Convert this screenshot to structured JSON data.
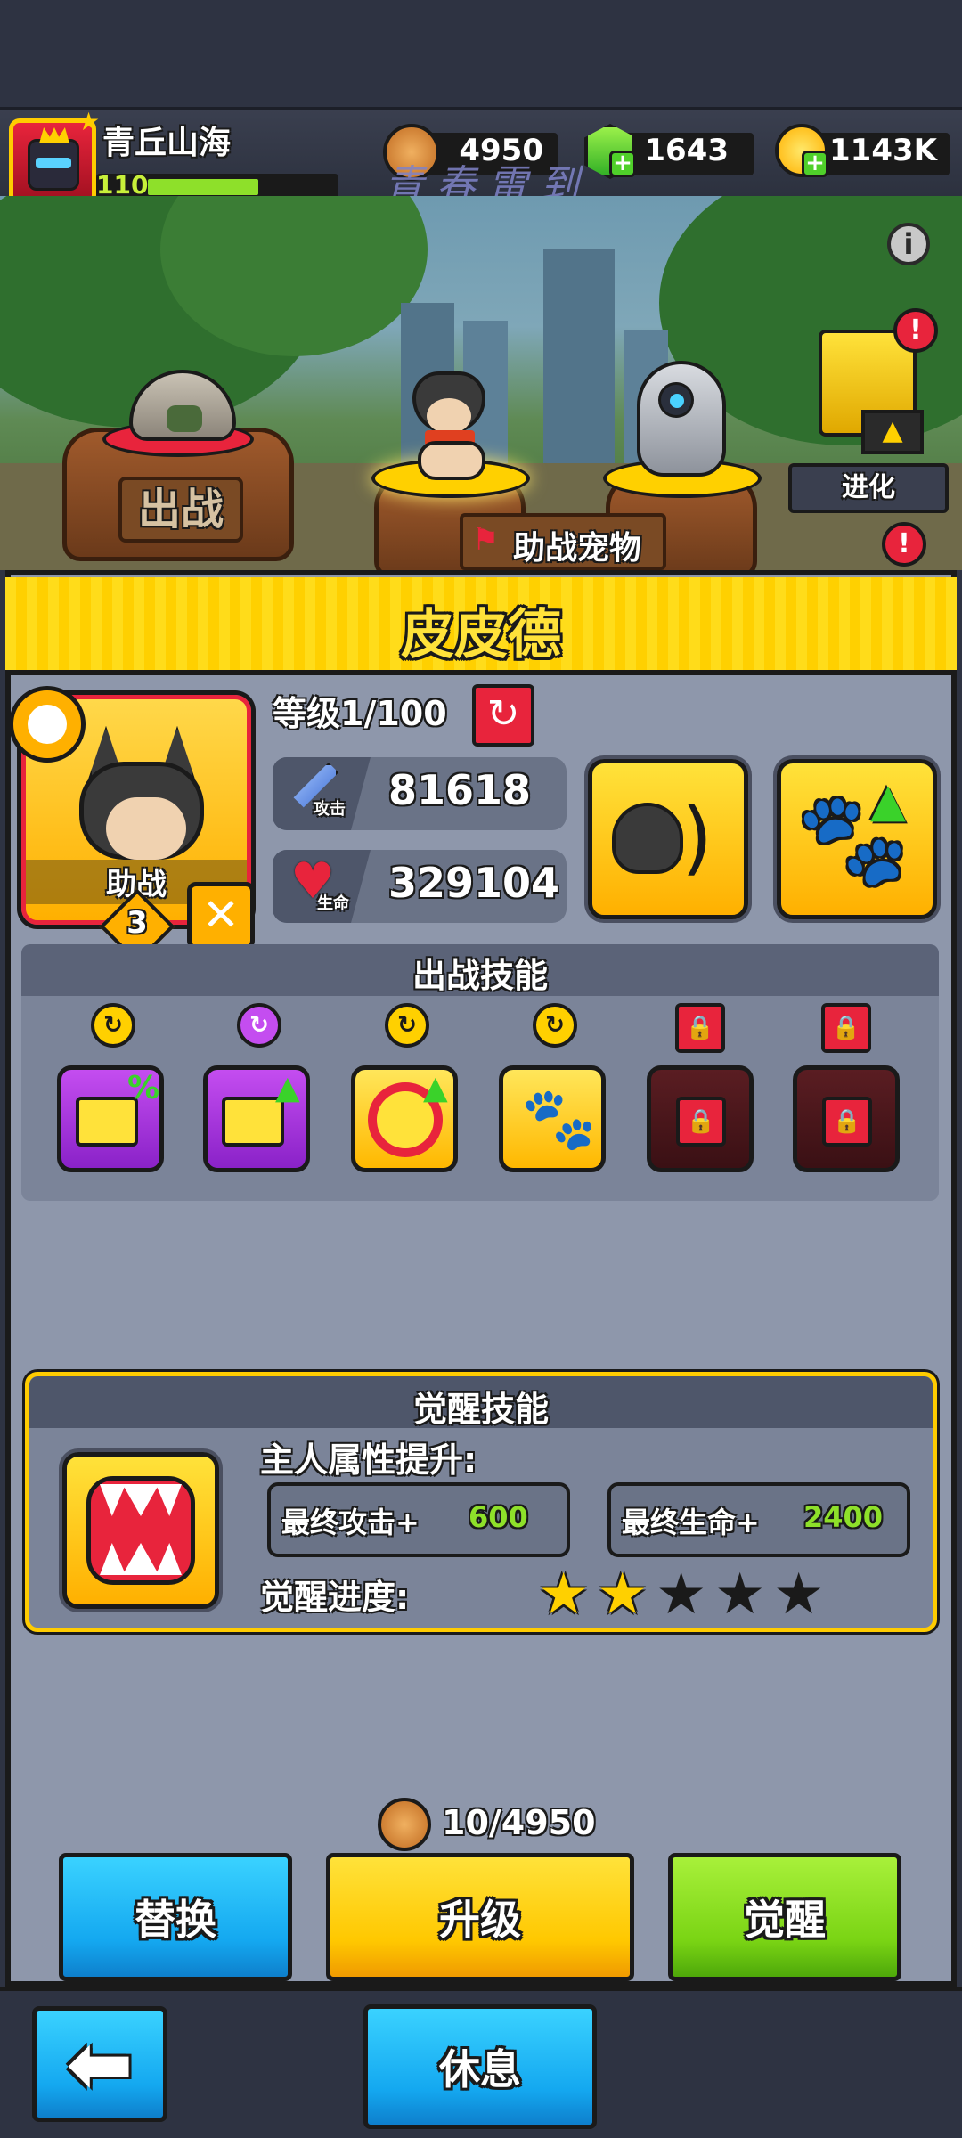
{
  "player": {
    "name": "青丘山海",
    "level": "110",
    "xp_fraction": 0.6
  },
  "currencies": [
    {
      "icon": "pet-food-coin-icon",
      "value": "4950"
    },
    {
      "icon": "green-gem-icon",
      "value": "1643"
    },
    {
      "icon": "gold-coin-icon",
      "value": "1143K"
    }
  ],
  "watermark": "青春雷到",
  "scene": {
    "deploy_label": "出战",
    "evolve_label": "进化",
    "assist_pet_label": "助战宠物"
  },
  "pet": {
    "name": "皮皮德",
    "role_label": "助战",
    "star_count": "3",
    "level_label": "等级1/100",
    "attack_icon_label": "攻击",
    "attack_value": "81618",
    "hp_icon_label": "生命",
    "hp_value": "329104"
  },
  "battle_skills": {
    "title": "出战技能",
    "skills": [
      {
        "name": "chest-percent-skill-icon",
        "style": "purple",
        "locked": false,
        "badge": "yellow"
      },
      {
        "name": "chest-up-skill-icon",
        "style": "purple",
        "locked": false,
        "badge": "purple"
      },
      {
        "name": "paw-target-skill-icon",
        "style": "yellow",
        "locked": false,
        "badge": "yellow"
      },
      {
        "name": "paw-fire-skill-icon",
        "style": "yellow",
        "locked": false,
        "badge": "yellow"
      },
      {
        "name": "locked-skill-icon",
        "style": "locked",
        "locked": true
      },
      {
        "name": "locked-skill-icon",
        "style": "locked",
        "locked": true
      }
    ]
  },
  "awaken": {
    "title": "觉醒技能",
    "owner_boost_label": "主人属性提升:",
    "final_attack_label": "最终攻击+",
    "final_attack_value": "600",
    "final_hp_label": "最终生命+",
    "final_hp_value": "2400",
    "progress_label": "觉醒进度:",
    "stars_filled": 2,
    "stars_total": 5
  },
  "upgrade_cost": "10/4950",
  "buttons": {
    "replace": "替换",
    "upgrade": "升级",
    "awaken": "觉醒",
    "rest": "休息"
  },
  "colors": {
    "accent_yellow": "#ffd000",
    "button_blue": "#14a8f0",
    "button_green": "#7ad414",
    "panel": "#8e97ab",
    "alert_red": "#e8243c"
  }
}
